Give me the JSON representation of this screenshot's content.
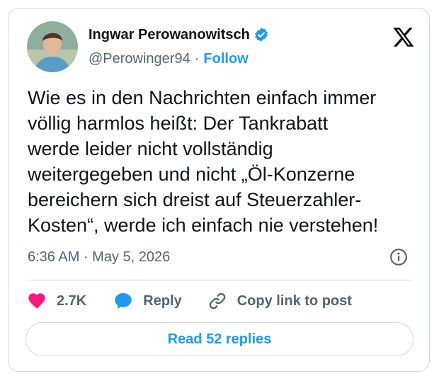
{
  "author": {
    "display_name": "Ingwar Perowanowitsch",
    "handle": "@Perowinger94",
    "separator": "·",
    "follow_label": "Follow",
    "verified": true
  },
  "tweet": {
    "text": "Wie es in den Nachrichten einfach immer\nvöllig harmlos heißt: Der Tankrabatt\nwerde leider nicht vollständig\nweitergegeben und nicht „Öl-Konzerne\nbereichern sich dreist auf Steuerzahler-\nKosten“, werde ich einfach nie verstehen!",
    "timestamp": "6:36 AM · May 5, 2026"
  },
  "actions": {
    "like_count": "2.7K",
    "reply_label": "Reply",
    "copy_link_label": "Copy link to post"
  },
  "read_replies_label": "Read 52 replies",
  "icons": {
    "logo": "x-logo-icon",
    "verified": "verified-badge-icon",
    "info": "info-icon",
    "like": "heart-icon",
    "reply": "speech-bubble-icon",
    "copy": "link-icon"
  },
  "colors": {
    "accent": "#1d9bf0",
    "like": "#f91880",
    "text": "#0f1419",
    "muted": "#536471",
    "border": "#cfd9de"
  }
}
